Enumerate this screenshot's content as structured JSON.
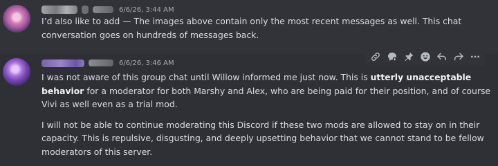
{
  "messages": [
    {
      "timestamp": "6/6/26, 3:44 AM",
      "paragraphs": [
        "I’d also like to add — The images above contain only the most recent messages as well. This chat conversation goes on hundreds of messages back."
      ]
    },
    {
      "timestamp": "6/6/26, 3:46 AM",
      "p1_pre": "I was not aware of this group chat until Willow informed me just now. This is ",
      "p1_bold": "utterly unacceptable behavior",
      "p1_post": " for a moderator for both Marshy and Alex, who are being paid for their position, and of course Vivi as well even as a trial mod.",
      "p2": "I will not be able to continue moderating this Discord if these two mods are allowed to stay on in their capacity. This is repulsive, disgusting, and deeply upsetting behavior that we cannot stand to be fellow moderators of this server."
    }
  ],
  "toolbar_icons": [
    "link-icon",
    "thread-icon",
    "pin-icon",
    "emoji-icon",
    "reply-icon",
    "forward-icon",
    "more-icon"
  ]
}
